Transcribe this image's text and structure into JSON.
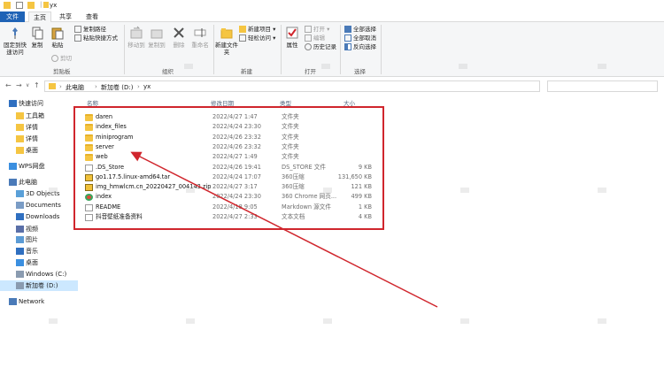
{
  "window": {
    "title": "yx"
  },
  "tabs": [
    {
      "label": "文件"
    },
    {
      "label": "主页"
    },
    {
      "label": "共享"
    },
    {
      "label": "查看"
    }
  ],
  "ribbon": {
    "clipboard": {
      "group_label": "剪贴板",
      "pin_label": "固定到快速访问",
      "copy_label": "复制",
      "paste_label": "粘贴",
      "copy_path_label": "复制路径",
      "paste_shortcut_label": "粘贴快捷方式",
      "cut_label": "剪切"
    },
    "organize": {
      "group_label": "组织",
      "move_to_label": "移动到",
      "copy_to_label": "复制到",
      "delete_label": "删除",
      "rename_label": "重命名"
    },
    "new": {
      "group_label": "新建",
      "new_folder_label": "新建文件夹",
      "new_item_label": "新建项目 ▾",
      "easy_access_label": "轻松访问 ▾"
    },
    "open": {
      "group_label": "打开",
      "properties_label": "属性",
      "open_label": "打开 ▾",
      "edit_label": "编辑",
      "history_label": "历史记录"
    },
    "select": {
      "group_label": "选择",
      "select_all_label": "全部选择",
      "select_none_label": "全部取消",
      "invert_label": "反向选择"
    }
  },
  "address": {
    "crumbs": [
      "此电脑",
      "新加卷 (D:)",
      "yx"
    ]
  },
  "sidebar": {
    "items": [
      {
        "label": "快速访问",
        "icon": "star-icon",
        "indent": false
      },
      {
        "label": "工具箱",
        "icon": "folder-icon",
        "indent": true
      },
      {
        "label": "详情",
        "icon": "folder-icon",
        "indent": true
      },
      {
        "label": "详情",
        "icon": "folder-icon",
        "indent": true
      },
      {
        "label": "桌面",
        "icon": "folder-icon",
        "indent": true
      },
      {
        "label": "WPS网盘",
        "icon": "cloud-icon",
        "indent": false
      },
      {
        "label": "此电脑",
        "icon": "computer-icon",
        "indent": false
      },
      {
        "label": "3D Objects",
        "icon": "cube-icon",
        "indent": true
      },
      {
        "label": "Documents",
        "icon": "document-icon",
        "indent": true
      },
      {
        "label": "Downloads",
        "icon": "download-icon",
        "indent": true
      },
      {
        "label": "视频",
        "icon": "video-icon",
        "indent": true
      },
      {
        "label": "图片",
        "icon": "picture-icon",
        "indent": true
      },
      {
        "label": "音乐",
        "icon": "music-icon",
        "indent": true
      },
      {
        "label": "桌面",
        "icon": "desktop-icon",
        "indent": true
      },
      {
        "label": "Windows (C:)",
        "icon": "drive-icon",
        "indent": true
      },
      {
        "label": "新加卷 (D:)",
        "icon": "drive-icon",
        "indent": true,
        "selected": true
      },
      {
        "label": "Network",
        "icon": "network-icon",
        "indent": false
      }
    ]
  },
  "columns": {
    "name": "名称",
    "date": "修改日期",
    "type": "类型",
    "size": "大小"
  },
  "files": [
    {
      "name": "daren",
      "date": "2022/4/27 1:47",
      "type": "文件夹",
      "size": "",
      "icon": "folder"
    },
    {
      "name": "index_files",
      "date": "2022/4/24 23:30",
      "type": "文件夹",
      "size": "",
      "icon": "folder"
    },
    {
      "name": "miniprogram",
      "date": "2022/4/26 23:32",
      "type": "文件夹",
      "size": "",
      "icon": "folder"
    },
    {
      "name": "server",
      "date": "2022/4/26 23:32",
      "type": "文件夹",
      "size": "",
      "icon": "folder"
    },
    {
      "name": "web",
      "date": "2022/4/27 1:49",
      "type": "文件夹",
      "size": "",
      "icon": "folder"
    },
    {
      "name": ".DS_Store",
      "date": "2022/4/26 19:41",
      "type": "DS_STORE 文件",
      "size": "9 KB",
      "icon": "file"
    },
    {
      "name": "go1.17.5.linux-amd64.tar",
      "date": "2022/4/24 17:07",
      "type": "360压缩",
      "size": "131,650 KB",
      "icon": "zip"
    },
    {
      "name": "img_hmwlcm.cn_20220427_004143.zip",
      "date": "2022/4/27 3:17",
      "type": "360压缩",
      "size": "121 KB",
      "icon": "zip"
    },
    {
      "name": "index",
      "date": "2022/4/24 23:30",
      "type": "360 Chrome 网页...",
      "size": "499 KB",
      "icon": "chrome"
    },
    {
      "name": "README",
      "date": "2022/4/18 9:05",
      "type": "Markdown 源文件",
      "size": "1 KB",
      "icon": "file"
    },
    {
      "name": "抖音壁纸准备资料",
      "date": "2022/4/27 2:33",
      "type": "文本文档",
      "size": "4 KB",
      "icon": "file"
    }
  ]
}
